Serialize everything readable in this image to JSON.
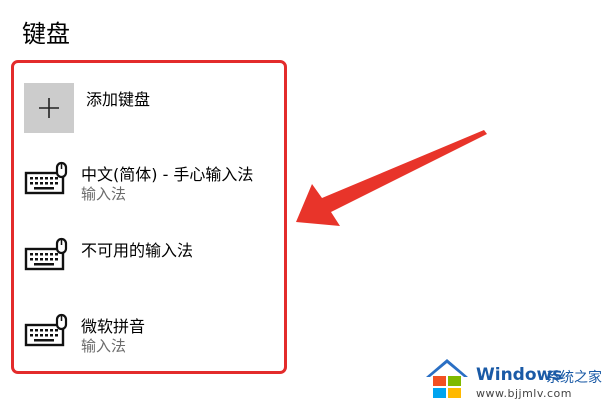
{
  "page": {
    "title": "键盘"
  },
  "add_keyboard": {
    "label": "添加键盘",
    "icon": "plus-icon"
  },
  "keyboards": [
    {
      "name": "中文(简体) - 手心输入法",
      "subtitle": "输入法",
      "icon": "keyboard-icon"
    },
    {
      "name": "不可用的输入法",
      "subtitle": "",
      "icon": "keyboard-icon"
    },
    {
      "name": "微软拼音",
      "subtitle": "输入法",
      "icon": "keyboard-icon"
    }
  ],
  "watermark": {
    "brand": "Windows",
    "site": "系统之家",
    "url": "www.bjjmlv.com"
  },
  "colors": {
    "highlight": "#e32b2b",
    "arrow": "#e8342a",
    "add_tile": "#cccccc",
    "subtitle": "#6b6b6b",
    "watermark": "#1a5aa6"
  }
}
